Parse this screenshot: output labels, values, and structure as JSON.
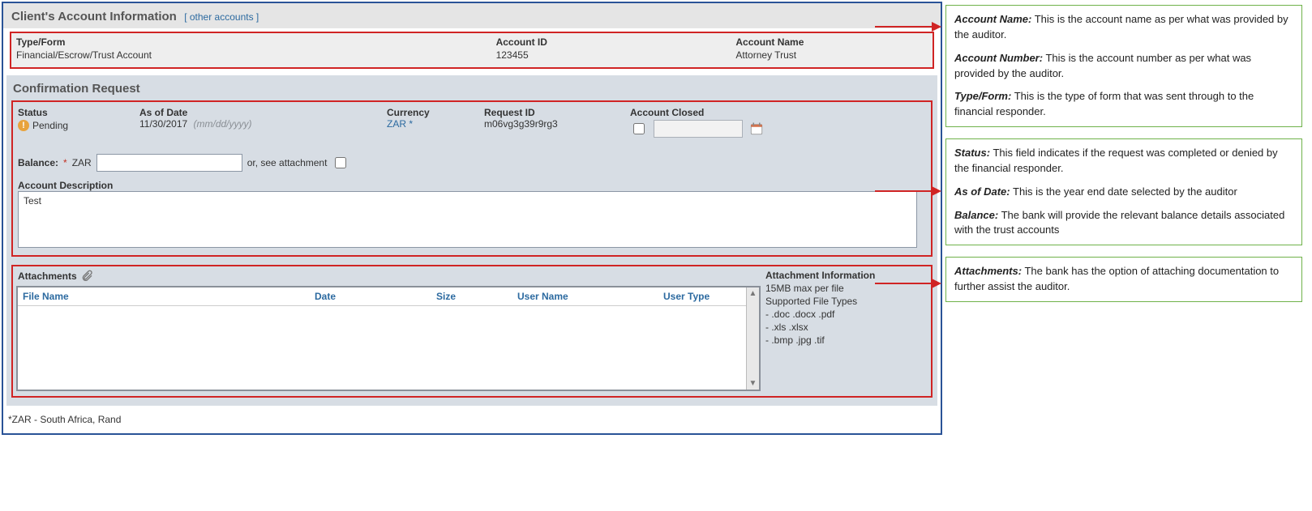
{
  "header": {
    "title": "Client's Account Information",
    "other_link": "[ other accounts ]"
  },
  "client": {
    "labels": {
      "type": "Type/Form",
      "id": "Account ID",
      "name": "Account Name"
    },
    "values": {
      "type": "Financial/Escrow/Trust Account",
      "id": "123455",
      "name": "Attorney Trust"
    }
  },
  "confirmation": {
    "title": "Confirmation Request",
    "labels": {
      "status": "Status",
      "asof": "As of Date",
      "currency": "Currency",
      "request": "Request ID",
      "closed": "Account Closed"
    },
    "status_value": "Pending",
    "asof_value": "11/30/2017",
    "asof_hint": "(mm/dd/yyyy)",
    "currency_value": "ZAR *",
    "request_value": "m06vg3g39r9rg3",
    "balance_label": "Balance:",
    "balance_star": "*",
    "balance_currency": "ZAR",
    "or_attach": "or, see attachment",
    "desc_label": "Account Description",
    "desc_value": "Test"
  },
  "attachments": {
    "title": "Attachments",
    "columns": {
      "file": "File Name",
      "date": "Date",
      "size": "Size",
      "user": "User Name",
      "type": "User Type"
    },
    "info": {
      "title": "Attachment Information",
      "max": "15MB max per file",
      "supported": "Supported File Types",
      "l1": "- .doc .docx .pdf",
      "l2": "- .xls .xlsx",
      "l3": "- .bmp .jpg .tif"
    }
  },
  "footnote": "*ZAR - South Africa, Rand",
  "annotations": {
    "box1": {
      "a_label": "Account Name:",
      "a_text": " This is the account name as per what was provided by the auditor.",
      "b_label": "Account Number:",
      "b_text": " This is the account number as per what was provided by the auditor.",
      "c_label": "Type/Form:",
      "c_text": " This is the type of form that was sent through to the financial responder."
    },
    "box2": {
      "a_label": "Status:",
      "a_text": " This field indicates if the request was completed or denied by the financial responder.",
      "b_label": "As of Date:",
      "b_text": " This is the year end date selected by the auditor",
      "c_label": "Balance:",
      "c_text": " The bank will provide the relevant balance details associated with the trust accounts"
    },
    "box3": {
      "a_label": "Attachments:",
      "a_text": " The bank has the option of attaching documentation to further assist the auditor."
    }
  }
}
